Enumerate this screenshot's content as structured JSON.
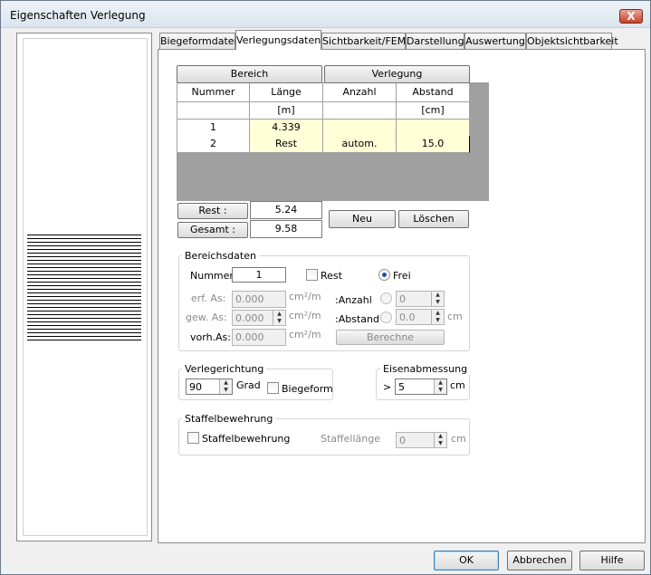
{
  "window": {
    "title": "Eigenschaften Verlegung",
    "close_glyph": "X"
  },
  "tabs": [
    "Biegeformdaten",
    "Verlegungsdaten",
    "Sichtbarkeit/FEM",
    "Darstellung",
    "Auswertung",
    "Objektsichtbarkeit"
  ],
  "active_tab": "Verlegungsdaten",
  "grid": {
    "button_bereich": "Bereich",
    "button_verlegung": "Verlegung",
    "headers": [
      "Nummer",
      "Länge",
      "Anzahl",
      "Abstand"
    ],
    "units": [
      "",
      "[m]",
      "",
      "[cm]"
    ],
    "rows": [
      [
        "1",
        "4.339",
        "",
        ""
      ],
      [
        "2",
        "Rest",
        "autom.",
        "15.0"
      ]
    ]
  },
  "totals": {
    "rest_label": "Rest :",
    "rest_value": "5.24",
    "gesamt_label": "Gesamt :",
    "gesamt_value": "9.58",
    "neu_label": "Neu",
    "loeschen_label": "Löschen"
  },
  "bereichsdaten": {
    "title": "Bereichsdaten",
    "nummer_label": "Nummer:",
    "nummer_value": "1",
    "rest_check_label": "Rest",
    "frei_label": "Frei",
    "erf_as_label": "erf. As:",
    "erf_as_value": "0.000",
    "gew_as_label": "gew. As:",
    "gew_as_value": "0.000",
    "vorh_as_label": "vorh.As:",
    "vorh_as_value": "0.000",
    "unit_as": "cm²/m",
    "anzahl_label": ":Anzahl",
    "anzahl_value": "0",
    "abstand_label": ":Abstand",
    "abstand_value": "0.0",
    "abstand_unit": "cm",
    "berechne_label": "Berechne"
  },
  "verlegerichtung": {
    "title": "Verlegerichtung",
    "value": "90",
    "unit": "Grad",
    "biegeform_label": "Biegeform"
  },
  "eisenabmessung": {
    "title": "Eisenabmessung",
    "prefix": ">",
    "value": "5",
    "unit": "cm"
  },
  "staffel": {
    "title": "Staffelbewehrung",
    "check_label": "Staffelbewehrung",
    "laenge_label": "Staffellänge",
    "laenge_value": "0",
    "unit": "cm"
  },
  "footer": {
    "ok": "OK",
    "abbrechen": "Abbrechen",
    "hilfe": "Hilfe"
  }
}
